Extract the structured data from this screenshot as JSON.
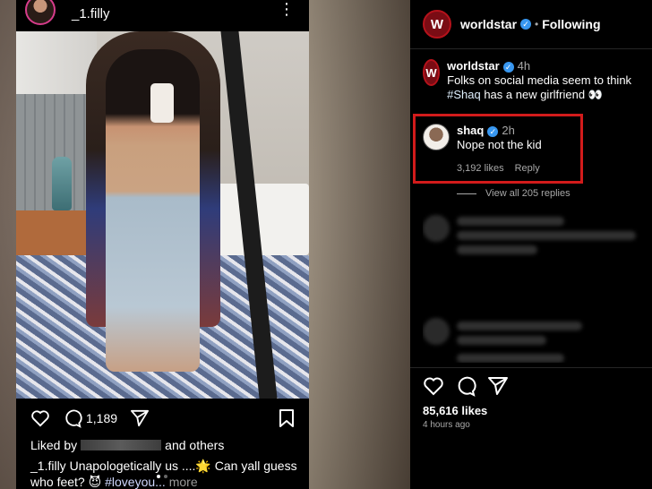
{
  "left_post": {
    "username": "_1.filly",
    "more_glyph": "⋮",
    "comment_count": "1,189",
    "liked_prefix": "Liked by",
    "liked_suffix": "and others",
    "caption_user": "_1.filly",
    "caption_text": " Unapologetically us ....🌟 Can yall guess who feet? 😈 ",
    "caption_tag": "#loveyou...",
    "caption_more": " more",
    "icons": [
      "heart-icon",
      "comment-icon",
      "share-icon",
      "bookmark-icon"
    ]
  },
  "right_panel": {
    "account": "worldstar",
    "follow_status": "Following",
    "logo_glyph": "W",
    "comment1": {
      "user": "worldstar",
      "time": "4h",
      "text": "Folks on social media seem to think ",
      "hashtag": "#Shaq",
      "text_end": " has a new girlfriend 👀"
    },
    "comment2": {
      "user": "shaq",
      "time": "2h",
      "text": "Nope not the kid",
      "likes": "3,192 likes",
      "reply": "Reply"
    },
    "view_replies": "View all 205 replies",
    "likes": "85,616 likes",
    "posted": "4 hours ago",
    "icons": [
      "heart-icon",
      "comment-icon",
      "share-icon"
    ]
  },
  "colors": {
    "highlight_border": "#d21b1b",
    "verified": "#3897f0",
    "worldstar_red": "#7a0c14"
  }
}
